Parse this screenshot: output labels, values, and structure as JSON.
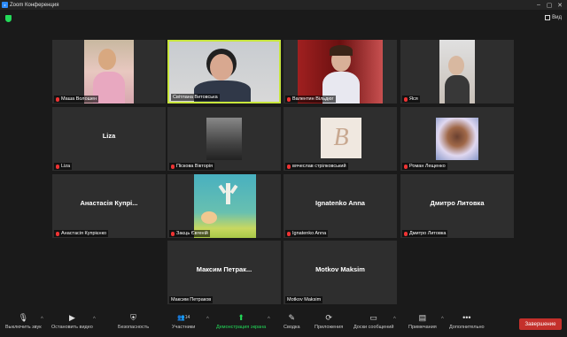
{
  "window": {
    "title": "Zoom Конференция",
    "view_label": "Вид"
  },
  "participants": [
    {
      "name": "Маша Волошен",
      "center": "",
      "muted": true
    },
    {
      "name": "Світлана Витовська",
      "center": "",
      "muted": false,
      "active": true
    },
    {
      "name": "Валентин Вільдюг",
      "center": "",
      "muted": true
    },
    {
      "name": "Яся",
      "center": "",
      "muted": true
    },
    {
      "name": "Liza",
      "center": "Liza",
      "muted": true
    },
    {
      "name": "Піскова Вікторія",
      "center": "",
      "muted": true
    },
    {
      "name": "вячеслав стрілковський",
      "center": "",
      "muted": true
    },
    {
      "name": "Роман Лещенко",
      "center": "",
      "muted": true
    },
    {
      "name": "Анастасія Купрієнко",
      "center": "Анастасія Купрі...",
      "muted": true
    },
    {
      "name": "Заєць Євгеній",
      "center": "",
      "muted": true
    },
    {
      "name": "Ignatenko Anna",
      "center": "Ignatenko Anna",
      "muted": true
    },
    {
      "name": "Дмитро Литовка",
      "center": "Дмитро Литовка",
      "muted": true
    },
    {
      "name": "Максим Петраков",
      "center": "Максим  Петрак...",
      "muted": false
    },
    {
      "name": "Motkov Maksim",
      "center": "Motkov Maksim",
      "muted": false
    }
  ],
  "toolbar": {
    "mute": "Выключить звук",
    "video": "Остановить видео",
    "security": "Безопасность",
    "participants": "Участники",
    "participants_count": "14",
    "share": "Демонстрация экрана",
    "summary": "Сводка",
    "apps": "Приложения",
    "whiteboards": "Доски сообщений",
    "notes": "Примечания",
    "more": "Дополнительно",
    "end": "Завершение"
  },
  "colors": {
    "active_border": "#c8e63c",
    "share_green": "#23d959",
    "end_red": "#c4302b"
  }
}
